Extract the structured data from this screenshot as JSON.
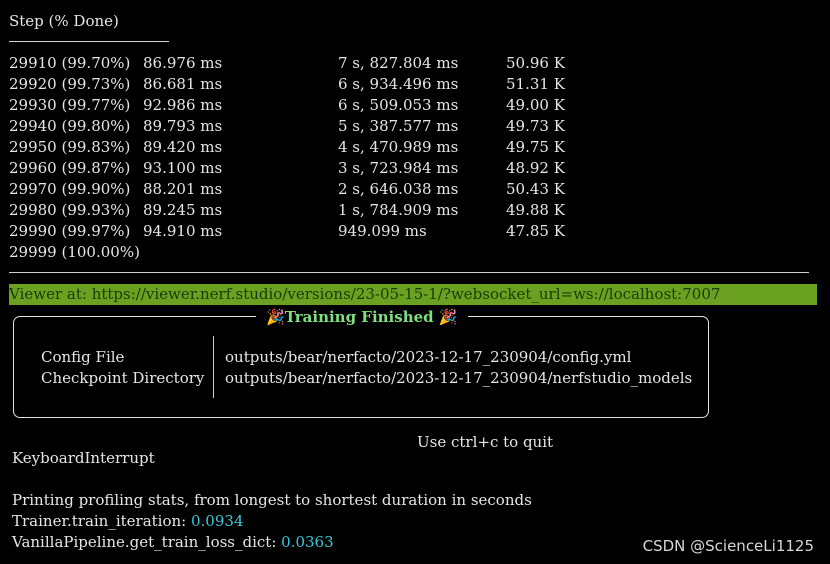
{
  "header": {
    "title": "Step (% Done)"
  },
  "rows": [
    {
      "step": "29910 (99.70%)",
      "iter_time": "86.976 ms",
      "eta": "7 s, 827.804 ms",
      "rays": "50.96 K"
    },
    {
      "step": "29920 (99.73%)",
      "iter_time": "86.681 ms",
      "eta": "6 s, 934.496 ms",
      "rays": "51.31 K"
    },
    {
      "step": "29930 (99.77%)",
      "iter_time": "92.986 ms",
      "eta": "6 s, 509.053 ms",
      "rays": "49.00 K"
    },
    {
      "step": "29940 (99.80%)",
      "iter_time": "89.793 ms",
      "eta": "5 s, 387.577 ms",
      "rays": "49.73 K"
    },
    {
      "step": "29950 (99.83%)",
      "iter_time": "89.420 ms",
      "eta": "4 s, 470.989 ms",
      "rays": "49.75 K"
    },
    {
      "step": "29960 (99.87%)",
      "iter_time": "93.100 ms",
      "eta": "3 s, 723.984 ms",
      "rays": "48.92 K"
    },
    {
      "step": "29970 (99.90%)",
      "iter_time": "88.201 ms",
      "eta": "2 s, 646.038 ms",
      "rays": "50.43 K"
    },
    {
      "step": "29980 (99.93%)",
      "iter_time": "89.245 ms",
      "eta": "1 s, 784.909 ms",
      "rays": "49.88 K"
    },
    {
      "step": "29990 (99.97%)",
      "iter_time": "94.910 ms",
      "eta": "949.099 ms",
      "rays": "47.85 K"
    },
    {
      "step": "29999 (100.00%)",
      "iter_time": "",
      "eta": "",
      "rays": ""
    }
  ],
  "viewer": {
    "text": "Viewer at: https://viewer.nerf.studio/versions/23-05-15-1/?websocket_url=ws://localhost:7007"
  },
  "panel": {
    "title": "Training Finished",
    "left_emoji": "🎉",
    "right_emoji": "🎉",
    "config_label": "Config File",
    "config_value": "outputs/bear/nerfacto/2023-12-17_230904/config.yml",
    "checkpoint_label": "Checkpoint Directory",
    "checkpoint_value": "outputs/bear/nerfacto/2023-12-17_230904/nerfstudio_models"
  },
  "quit_hint": "Use ctrl+c to quit",
  "interrupt": "KeyboardInterrupt",
  "profiling": {
    "heading": "Printing profiling stats, from longest to shortest duration in seconds",
    "items": [
      {
        "label": "Trainer.train_iteration: ",
        "value": "0.0934"
      },
      {
        "label": "VanillaPipeline.get_train_loss_dict: ",
        "value": "0.0363"
      }
    ]
  },
  "watermark": "CSDN @ScienceLi1125",
  "colors": {
    "background": "#000000",
    "viewer_bg": "#6aa121",
    "title_green": "#7fe07f",
    "value_cyan": "#39c8d8"
  }
}
